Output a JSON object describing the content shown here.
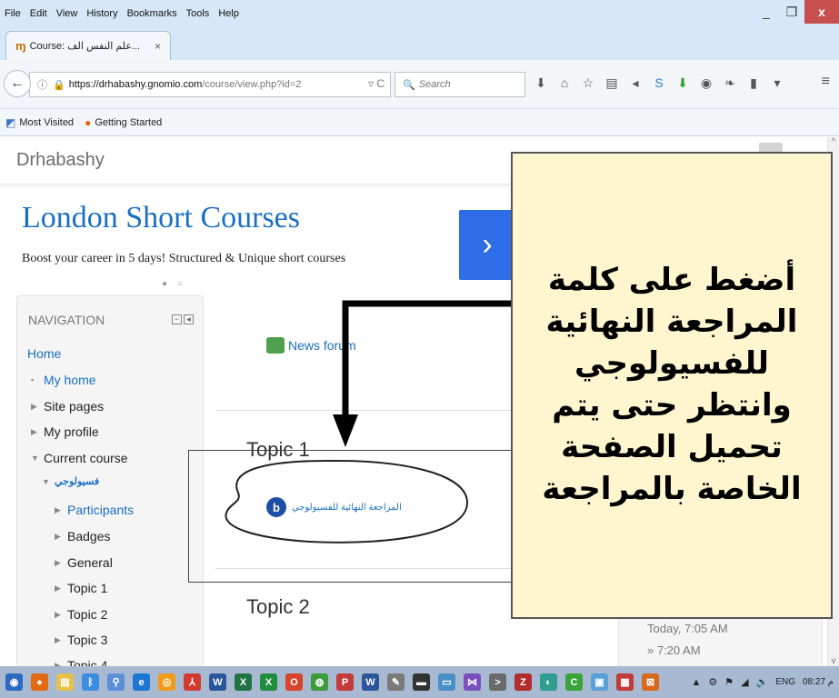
{
  "menubar": {
    "items": [
      "File",
      "Edit",
      "View",
      "History",
      "Bookmarks",
      "Tools",
      "Help"
    ]
  },
  "window_controls": {
    "minimize": "_",
    "maximize": "❐",
    "close": "x"
  },
  "tab": {
    "title": "Course: علم النفس الف...",
    "close": "×",
    "new_tab": "+"
  },
  "address": {
    "host": "https://drhabashy.gnomio.com",
    "path": "/course/view.php?id=2"
  },
  "search": {
    "placeholder": "Search"
  },
  "bookmarks": {
    "items": [
      "Most Visited",
      "Getting Started"
    ]
  },
  "site": {
    "name": "Drhabashy"
  },
  "ad": {
    "title": "London Short Courses",
    "subtitle": "Boost your career in 5 days! Structured & Unique short courses",
    "next": "›"
  },
  "navigation": {
    "heading": "NAVIGATION",
    "items": [
      {
        "label": "Home"
      },
      {
        "label": "My home"
      },
      {
        "label": "Site pages"
      },
      {
        "label": "My profile"
      },
      {
        "label": "Current course"
      },
      {
        "label": "فسيولوجي"
      },
      {
        "label": "Participants"
      },
      {
        "label": "Badges"
      },
      {
        "label": "General"
      },
      {
        "label": "Topic 1"
      },
      {
        "label": "Topic 2"
      },
      {
        "label": "Topic 3"
      },
      {
        "label": "Topic 4"
      }
    ]
  },
  "main": {
    "forum": "News forum",
    "topic1": "Topic 1",
    "topic2": "Topic 2",
    "activity": "المراجعة النهائية للفسيولوجي"
  },
  "right_block": {
    "line1": "Today, 7:05 AM",
    "line2": "» 7:20 AM"
  },
  "callout": {
    "text": "أضغط على كلمة المراجعة النهائية للفسيولوجي وانتظر حتى يتم تحميل الصفحة الخاصة بالمراجعة"
  },
  "taskbar": {
    "lang": "ENG",
    "time": "08:27 م"
  },
  "colors": {
    "link": "#1a6fc4",
    "callout_bg": "#fff5cf",
    "chrome": "#d6e8f8",
    "taskbar": "#a8b9d2"
  }
}
